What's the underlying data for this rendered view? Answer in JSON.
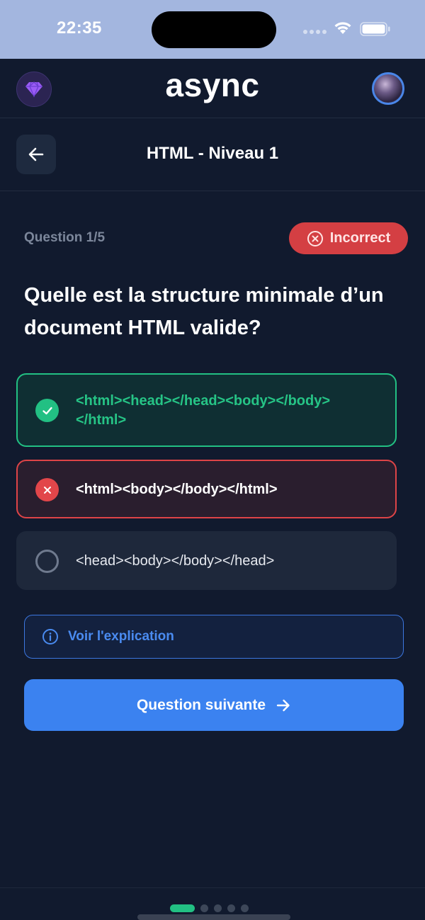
{
  "status_bar": {
    "time": "22:35"
  },
  "header": {
    "logo": "async"
  },
  "titlebar": {
    "title": "HTML - Niveau 1"
  },
  "question": {
    "counter": "Question 1/5",
    "status": "Incorrect",
    "text": "Quelle est la structure minimale d’un document HTML valide?"
  },
  "options": [
    {
      "label": "<html><head></head><body></body></html>",
      "state": "correct"
    },
    {
      "label": "<html><body></body></html>",
      "state": "wrong"
    },
    {
      "label": "<head><body></body></head>",
      "state": "neutral"
    }
  ],
  "actions": {
    "explain_label": "Voir l'explication",
    "next_label": "Question suivante"
  },
  "progress": {
    "current": 1,
    "total": 5
  },
  "colors": {
    "background": "#111a2e",
    "correct": "#22c083",
    "wrong": "#dd4447",
    "primary": "#3b82f0"
  }
}
